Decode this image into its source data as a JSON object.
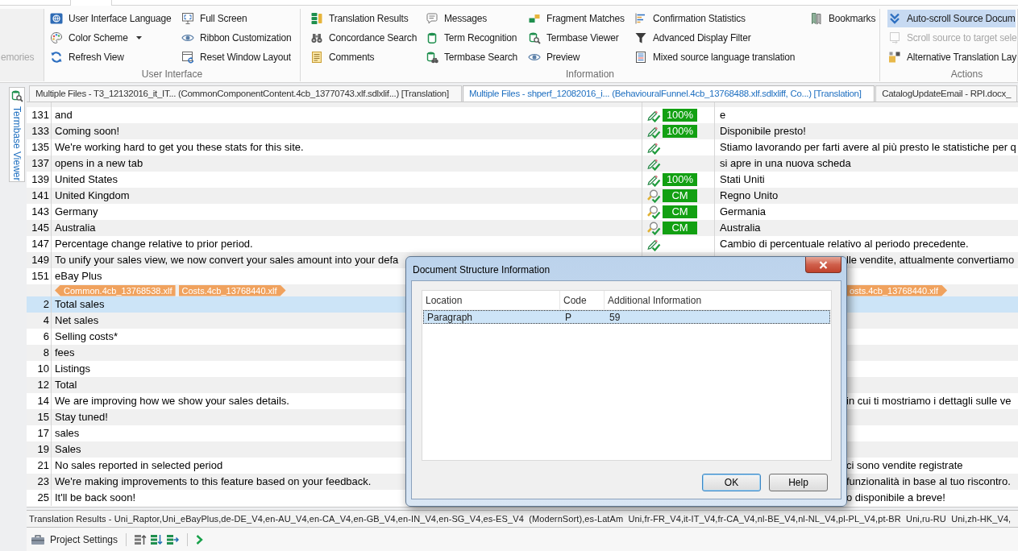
{
  "ribbon": {
    "groups": [
      {
        "items": [
          {
            "label": "emories",
            "disabled": true
          }
        ]
      },
      {
        "label": "User Interface",
        "items": [
          {
            "label": "User Interface Language",
            "dropdown": false
          },
          {
            "label": "Color Scheme",
            "dropdown": true
          },
          {
            "label": "Refresh View",
            "dropdown": false
          },
          {
            "label": "Full Screen",
            "dropdown": false
          },
          {
            "label": "Ribbon Customization",
            "dropdown": false
          },
          {
            "label": "Reset Window Layout",
            "dropdown": false
          }
        ]
      },
      {
        "label": "Information",
        "items": [
          {
            "label": "Translation Results"
          },
          {
            "label": "Concordance Search"
          },
          {
            "label": "Comments"
          },
          {
            "label": "Messages"
          },
          {
            "label": "Term Recognition"
          },
          {
            "label": "Termbase Search"
          },
          {
            "label": "Fragment Matches"
          },
          {
            "label": "Termbase Viewer"
          },
          {
            "label": "Preview"
          },
          {
            "label": "Confirmation Statistics"
          },
          {
            "label": "Advanced Display Filter"
          },
          {
            "label": "Mixed source language translation"
          },
          {
            "label": "Bookmarks"
          }
        ]
      },
      {
        "label": "Actions",
        "items": [
          {
            "label": "Auto-scroll Source Docum",
            "on": true,
            "disabled": false
          },
          {
            "label": "Scroll source to target sele",
            "on": false,
            "disabled": true
          },
          {
            "label": "Alternative Translation Lay",
            "on": false,
            "disabled": false
          }
        ]
      }
    ]
  },
  "side_panel": {
    "tab": "Termbase Viewer"
  },
  "document_tabs": [
    {
      "label": "Multiple Files - T3_12132016_it_IT... (CommonComponentContent.4cb_13770743.xlf.sdlxlif...) [Translation]",
      "selected": false
    },
    {
      "label": "Multiple Files - shperf_12082016_i... (BehaviouralFunnel.4cb_13768488.xlf.sdlxliff, Co...) [Translation]",
      "selected": true
    },
    {
      "label": "CatalogUpdateEmail - RPI.docx_",
      "selected": false
    }
  ],
  "grid": {
    "rows": [
      {
        "kind": "segment",
        "number": "131",
        "source": "and",
        "translated": true,
        "approved": false,
        "match": "100%",
        "target": "e",
        "selected": false
      },
      {
        "kind": "segment",
        "number": "133",
        "source": "Coming soon!",
        "translated": true,
        "approved": false,
        "match": "100%",
        "target": "Disponibile presto!",
        "selected": false
      },
      {
        "kind": "segment",
        "number": "135",
        "source": "We're working hard to get you these stats for this site.",
        "translated": true,
        "approved": false,
        "target": "Stiamo lavorando per farti avere al più presto le statistiche per q",
        "selected": false
      },
      {
        "kind": "segment",
        "number": "137",
        "source": "opens in a new tab",
        "translated": true,
        "approved": false,
        "target": "si apre in una nuova scheda",
        "selected": false
      },
      {
        "kind": "segment",
        "number": "139",
        "source": "United States",
        "translated": true,
        "approved": false,
        "match": "100%",
        "target": "Stati Uniti",
        "selected": false
      },
      {
        "kind": "segment",
        "number": "141",
        "source": "United Kingdom",
        "translated": true,
        "approved": true,
        "match": "CM",
        "target": "Regno Unito",
        "selected": false
      },
      {
        "kind": "segment",
        "number": "143",
        "source": "Germany",
        "translated": true,
        "approved": true,
        "match": "CM",
        "target": "Germania",
        "selected": false
      },
      {
        "kind": "segment",
        "number": "145",
        "source": "Australia",
        "translated": true,
        "approved": true,
        "match": "CM",
        "target": "Australia",
        "selected": false
      },
      {
        "kind": "segment",
        "number": "147",
        "source": "Percentage change relative to prior period.",
        "translated": true,
        "approved": false,
        "target": "Cambio di percentuale relativo al periodo precedente.",
        "selected": false
      },
      {
        "kind": "segment",
        "number": "149",
        "source": "To unify your sales view, we now convert your sales amount into your defa",
        "target": "lle vendite, attualmente convertiamo",
        "covered": true,
        "selected": false
      },
      {
        "kind": "segment",
        "number": "151",
        "source": "eBay Plus",
        "selected": false
      },
      {
        "kind": "files",
        "source_tags": [
          "Common.4cb_13768538.xlf",
          "Costs.4cb_13768440.xlf"
        ],
        "target_tags": [
          "osts.4cb_13768440.xlf"
        ],
        "covered": true,
        "selected": false
      },
      {
        "kind": "segment",
        "number": "2",
        "source": "Total sales",
        "selected": true
      },
      {
        "kind": "segment",
        "number": "4",
        "source": "Net sales",
        "selected": false
      },
      {
        "kind": "segment",
        "number": "6",
        "source": "Selling costs*",
        "selected": false
      },
      {
        "kind": "segment",
        "number": "8",
        "source": "fees",
        "selected": false
      },
      {
        "kind": "segment",
        "number": "10",
        "source": "Listings",
        "selected": false
      },
      {
        "kind": "segment",
        "number": "12",
        "source": "Total",
        "selected": false
      },
      {
        "kind": "segment",
        "number": "14",
        "source": "We are improving how we show your sales details.",
        "target": "in cui ti mostriamo i dettagli sulle ve",
        "covered": true,
        "selected": false
      },
      {
        "kind": "segment",
        "number": "15",
        "source": "Stay tuned!",
        "selected": false
      },
      {
        "kind": "segment",
        "number": "17",
        "source": "sales",
        "selected": false
      },
      {
        "kind": "segment",
        "number": "19",
        "source": "Sales",
        "selected": false
      },
      {
        "kind": "segment",
        "number": "21",
        "source": "No sales reported in selected period",
        "target": "ci sono vendite registrate",
        "covered": true,
        "selected": false
      },
      {
        "kind": "segment",
        "number": "23",
        "source": "We're making improvements to this feature based on your feedback.",
        "target": "funzionalità in base al tuo riscontro.",
        "covered": true,
        "selected": false
      },
      {
        "kind": "segment",
        "number": "25",
        "source": "It'll be back soon!",
        "target": "o disponibile a breve!",
        "covered": true,
        "selected": false
      }
    ]
  },
  "results_bar": {
    "text": "Translation Results - Uni_Raptor,Uni_eBayPlus,de-DE_V4,en-AU_V4,en-CA_V4,en-GB_V4,en-IN_V4,en-SG_V4,es-ES_V4  (ModernSort),es-LatAm  Uni,fr-FR_V4,it-IT_V4,fr-CA_V4,nl-BE_V4,nl-NL_V4,pl-PL_V4,pt-BR  Uni,ru-RU  Uni,zh-HK_V4,"
  },
  "toolbar": {
    "label": "Project Settings"
  },
  "dialog": {
    "title": "Document Structure Information",
    "columns": [
      "Location",
      "Code",
      "Additional Information"
    ],
    "rows": [
      {
        "cells": [
          "Paragraph",
          "P",
          "59"
        ],
        "selected": true
      }
    ],
    "buttons": [
      {
        "label": "OK",
        "default": true
      },
      {
        "label": "Help",
        "default": false
      }
    ]
  }
}
